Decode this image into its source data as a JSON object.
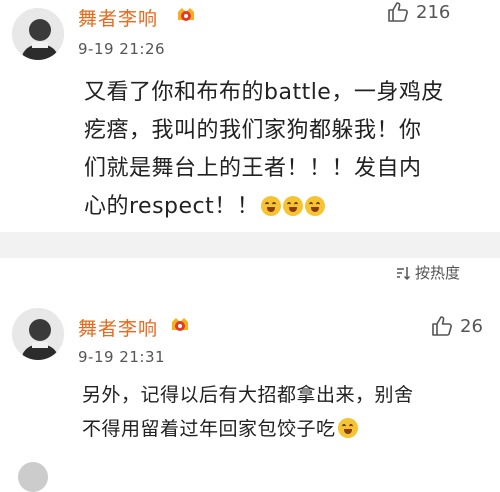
{
  "comments": [
    {
      "username": "舞者李响",
      "timestamp": "9-19 21:26",
      "likes": "216",
      "text_line1": "又看了你和布布的battle，一身鸡皮",
      "text_line2": "疙瘩，我叫的我们家狗都躲我！你",
      "text_line3": "们就是舞台上的王者！！！发自内",
      "text_line4": "心的respect！！"
    },
    {
      "username": "舞者李响",
      "timestamp": "9-19 21:31",
      "likes": "26",
      "text_line1": "另外，记得以后有大招都拿出来，别舍",
      "text_line2": "不得用留着过年回家包饺子吃"
    }
  ],
  "sort": {
    "label": "按热度"
  },
  "colors": {
    "username": "#e86a1e",
    "divider": "#f2f2f2"
  },
  "icons": [
    "avatar",
    "verified-badge-icon",
    "thumbs-up-icon",
    "laughing-crying-emoji",
    "sort-icon"
  ]
}
